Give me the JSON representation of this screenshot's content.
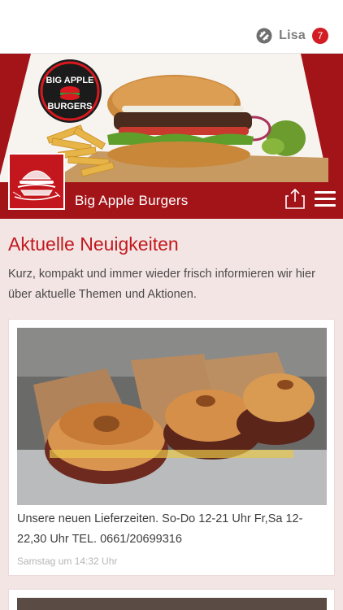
{
  "topbar": {
    "user_name": "Lisa",
    "badge_count": "7",
    "icons": [
      "app-switch-icon"
    ]
  },
  "header": {
    "logo_text_top": "BIG APPLE",
    "logo_text_bottom": "BURGERS",
    "brand_name": "Big Apple Burgers",
    "icons": [
      "share-icon",
      "menu-icon"
    ]
  },
  "main": {
    "headline": "Aktuelle Neuigkeiten",
    "intro": "Kurz, kompakt und immer wieder frisch informieren wir hier über aktuelle Themen und Aktionen.",
    "posts": [
      {
        "text": "Unsere neuen Lieferzeiten. So-Do 12-21 Uhr Fr,Sa 12-22,30 Uhr TEL. 0661/20699316",
        "time": "Samstag um 14:32 Uhr"
      }
    ]
  },
  "colors": {
    "brand_red": "#c2181e",
    "banner_red": "#a31419",
    "page_bg": "#f3e5e3",
    "badge_red": "#d11d23"
  }
}
